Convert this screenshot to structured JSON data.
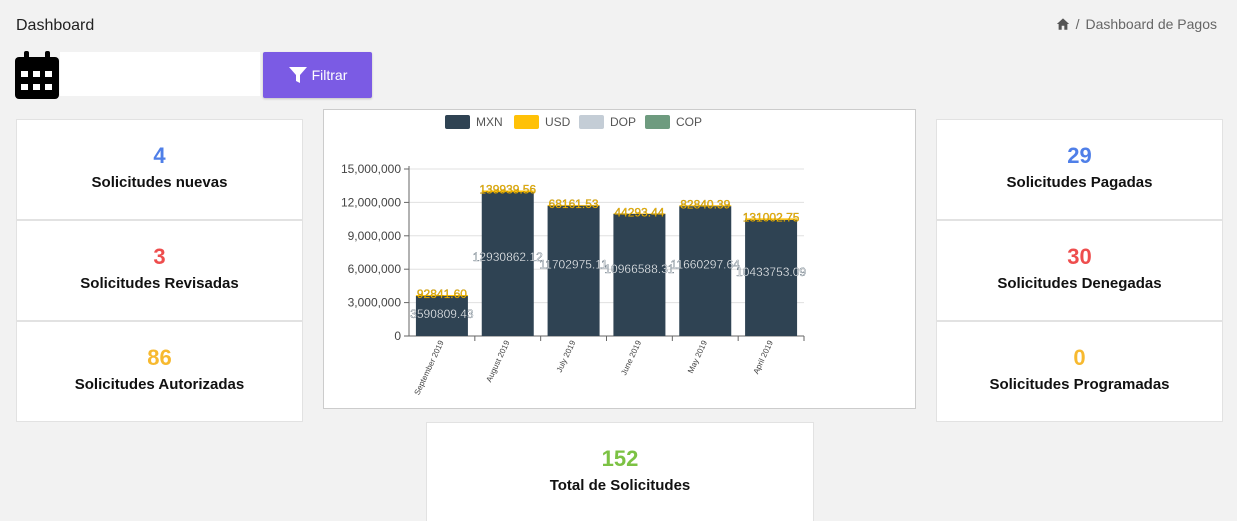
{
  "header": {
    "title": "Dashboard"
  },
  "breadcrumb": {
    "current": "Dashboard de Pagos"
  },
  "filter": {
    "date_value": "",
    "button_label": "Filtrar"
  },
  "cards_left": [
    {
      "value": "4",
      "label": "Solicitudes nuevas",
      "color": "#4f7fe8"
    },
    {
      "value": "3",
      "label": "Solicitudes Revisadas",
      "color": "#ee4d4d"
    },
    {
      "value": "86",
      "label": "Solicitudes Autorizadas",
      "color": "#f7b92f"
    }
  ],
  "cards_right": [
    {
      "value": "29",
      "label": "Solicitudes Pagadas",
      "color": "#4f7fe8"
    },
    {
      "value": "30",
      "label": "Solicitudes Denegadas",
      "color": "#ee4d4d"
    },
    {
      "value": "0",
      "label": "Solicitudes Programadas",
      "color": "#f7b92f"
    }
  ],
  "total": {
    "value": "152",
    "label": "Total de Solicitudes",
    "color": "#7cc244"
  },
  "chart_data": {
    "type": "bar",
    "categories": [
      "September 2019",
      "August 2019",
      "July 2019",
      "June 2019",
      "May 2019",
      "April 2019"
    ],
    "series": [
      {
        "name": "MXN",
        "color": "#2f4353",
        "values": [
          3590809.43,
          12930862.12,
          11702975.11,
          10966588.31,
          11660297.64,
          10433753.09
        ],
        "labels": [
          "3590809.43",
          "12930862.12",
          "11702975.11",
          "10966588.31",
          "11660297.64",
          "10433753.09"
        ]
      },
      {
        "name": "USD",
        "color": "#ffc107",
        "values": [
          92841.6,
          139939.56,
          68161.53,
          44293.44,
          82840.39,
          131002.75
        ],
        "labels": [
          "92841.60",
          "139939.56",
          "68161.53",
          "44293.44",
          "82840.39",
          "131002.75"
        ]
      },
      {
        "name": "DOP",
        "color": "#c4cdd6",
        "values": [
          0,
          0,
          0,
          0,
          0,
          0
        ]
      },
      {
        "name": "COP",
        "color": "#6e9b7f",
        "values": [
          0,
          0,
          0,
          0,
          0,
          0
        ]
      }
    ],
    "yticks": [
      "0",
      "3,000,000",
      "6,000,000",
      "9,000,000",
      "12,000,000",
      "15,000,000"
    ],
    "ylim": [
      0,
      15000000
    ],
    "stacked": true,
    "legend": "top"
  }
}
